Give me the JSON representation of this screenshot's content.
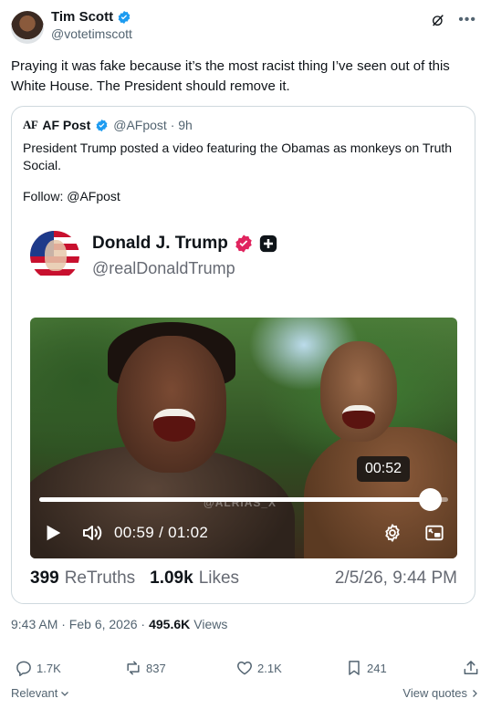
{
  "tweet": {
    "author_name": "Tim Scott",
    "author_handle": "@votetimscott",
    "text": "Praying it was fake because it’s the most racist thing I’ve seen out of this White House. The President should remove it."
  },
  "quoted": {
    "logo_text": "AF",
    "name": "AF Post",
    "handle_time": "@AFpost · 9h",
    "text": "President Trump posted a video featuring the Obamas as monkeys on Truth Social.",
    "follow": "Follow: @AFpost",
    "truth": {
      "name": "Donald J. Trump",
      "handle": "@realDonaldTrump",
      "video": {
        "watermark": "@ALRIAS_X",
        "tooltip": "00:52",
        "time": "00:59 / 01:02",
        "progress": 0.955
      },
      "retruths_count": "399",
      "retruths_label": "ReTruths",
      "likes_count": "1.09k",
      "likes_label": "Likes",
      "date": "2/5/26, 9:44 PM"
    }
  },
  "meta": {
    "time_date": "9:43 AM · Feb 6, 2026 ·",
    "views_count": "495.6K",
    "views_label": "Views"
  },
  "actions": {
    "replies": "1.7K",
    "reposts": "837",
    "likes": "2.1K",
    "bookmarks": "241"
  },
  "footer": {
    "relevant": "Relevant",
    "view_quotes": "View quotes"
  },
  "colors": {
    "verified_blue": "#1d9bf0",
    "truth_badge_red": "#e0245e",
    "secondary_text": "#536471"
  },
  "icons": [
    "verified-icon",
    "grok-icon",
    "more-icon",
    "play-icon",
    "volume-icon",
    "settings-icon",
    "pip-icon",
    "reply-icon",
    "repost-icon",
    "like-icon",
    "bookmark-icon",
    "share-icon",
    "chevron-down-icon",
    "chevron-right-icon"
  ]
}
